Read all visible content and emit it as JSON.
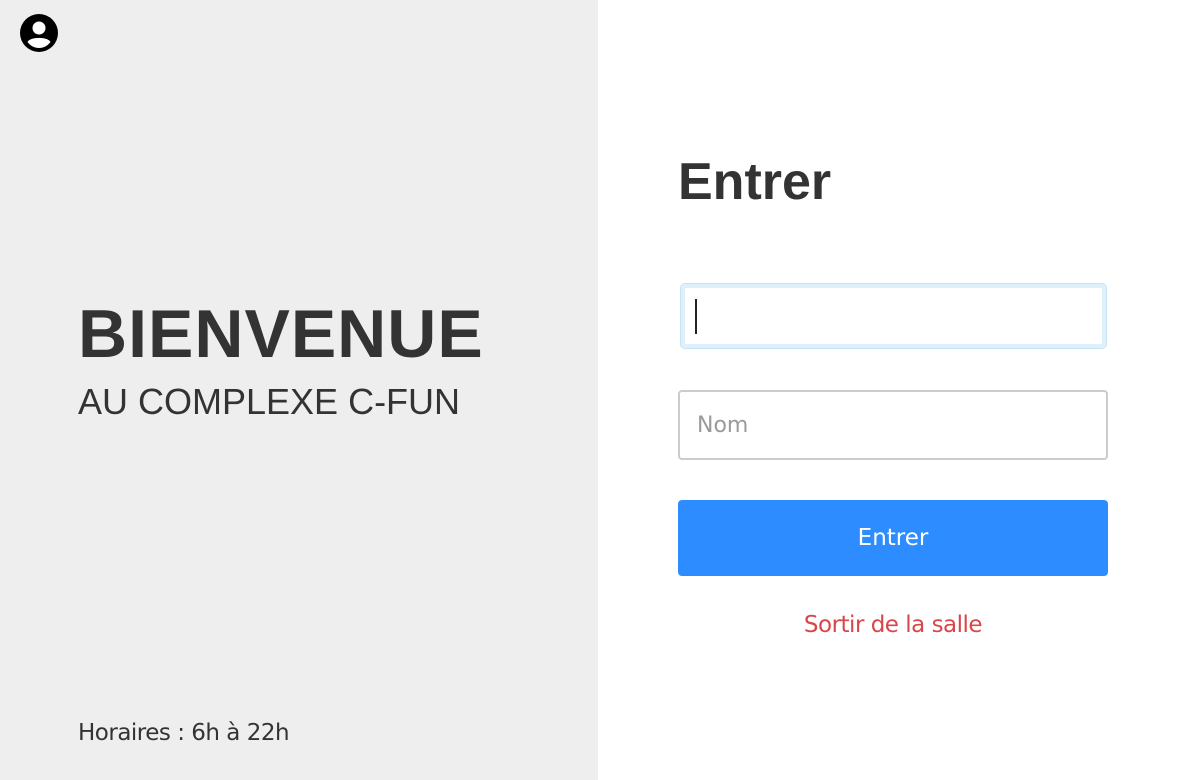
{
  "header": {
    "account_icon": "account-circle-icon"
  },
  "welcome": {
    "title": "BIENVENUE",
    "subtitle": "AU COMPLEXE C-FUN",
    "hours": "Horaires : 6h à 22h"
  },
  "form": {
    "title": "Entrer",
    "code_input": {
      "value": "",
      "placeholder": ""
    },
    "name_input": {
      "value": "",
      "placeholder": "Nom"
    },
    "submit_label": "Entrer",
    "exit_label": "Sortir de la salle"
  },
  "colors": {
    "left_background": "#eeeeee",
    "right_background": "#ffffff",
    "primary_button": "#2d8cff",
    "exit_link": "#d9464a",
    "text": "#333333"
  }
}
